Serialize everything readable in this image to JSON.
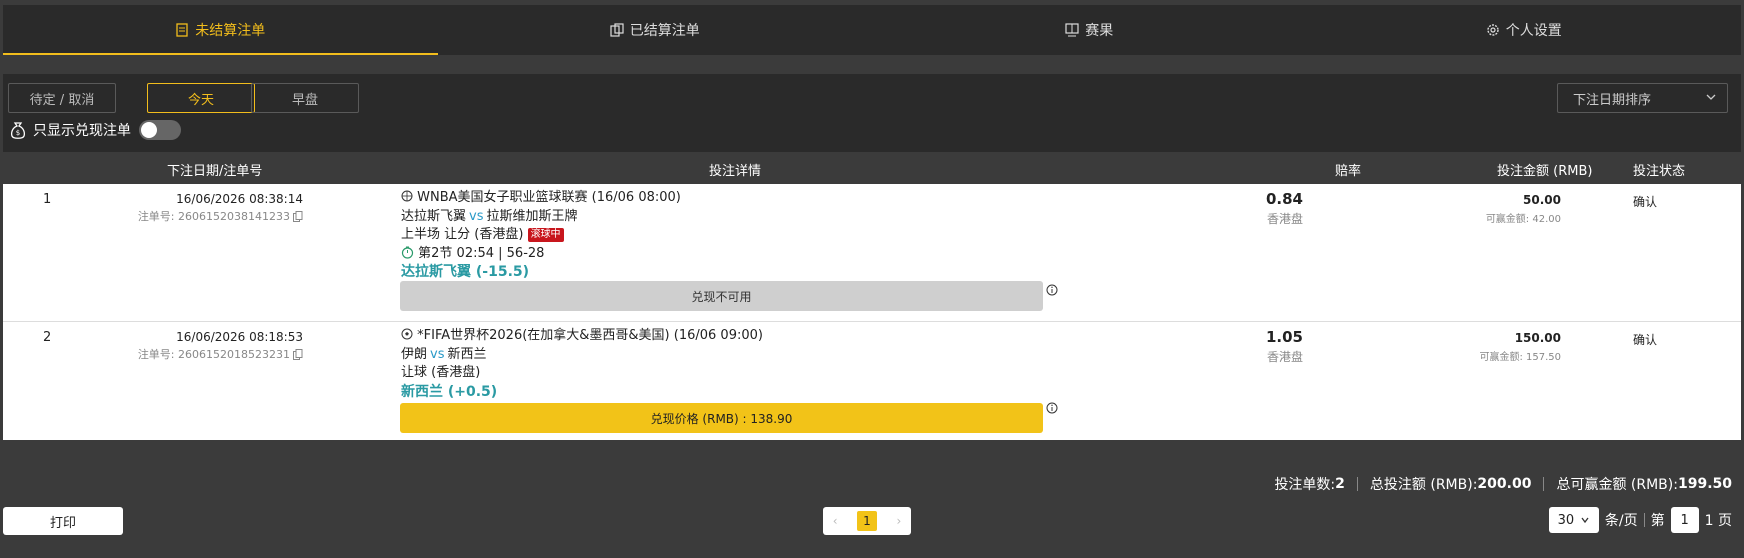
{
  "tabs": [
    {
      "label": "未结算注单",
      "icon": "ticket-icon",
      "active": true
    },
    {
      "label": "已结算注单",
      "icon": "copy-ticket-icon",
      "active": false
    },
    {
      "label": "赛果",
      "icon": "scoreboard-icon",
      "active": false
    },
    {
      "label": "个人设置",
      "icon": "gear-icon",
      "active": false
    }
  ],
  "filters": {
    "buttons": [
      "待定 / 取消",
      "今天",
      "早盘"
    ],
    "active": "今天",
    "sort_value": "下注日期排序",
    "cashout_only_label": "只显示兑现注单",
    "cashout_only_on": false
  },
  "table": {
    "headers": {
      "date": "下注日期/注单号",
      "detail": "投注详情",
      "odds": "赔率",
      "amount": "投注金额 (RMB)",
      "status": "投注状态"
    },
    "rows": [
      {
        "index": "1",
        "date": "16/06/2026 08:38:14",
        "order_label": "注单号: 2606152038141233",
        "league_icon": "basketball-icon",
        "league": "WNBA美国女子职业篮球联赛 (16/06 08:00)",
        "home": "达拉斯飞翼",
        "vs": "vs",
        "away": "拉斯维加斯王牌",
        "market": "上半场 让分 (香港盘)",
        "live_badge": "滚球中",
        "live_info": "第2节 02:54 | 56-28",
        "pick": "达拉斯飞翼 (-15.5)",
        "cashout_label": "兑现不可用",
        "cashout_available": false,
        "odds": "0.84",
        "odds_type": "香港盘",
        "stake": "50.00",
        "win_label": "可赢金额: 42.00",
        "status": "确认"
      },
      {
        "index": "2",
        "date": "16/06/2026 08:18:53",
        "order_label": "注单号: 2606152018523231",
        "league_icon": "soccer-ball-icon",
        "league": "*FIFA世界杯2026(在加拿大&墨西哥&美国) (16/06 09:00)",
        "home": "伊朗",
        "vs": "vs",
        "away": "新西兰",
        "market": "让球 (香港盘)",
        "pick": "新西兰 (+0.5)",
        "cashout_label": "兑现价格 (RMB) : 138.90",
        "cashout_available": true,
        "odds": "1.05",
        "odds_type": "香港盘",
        "stake": "150.00",
        "win_label": "可赢金额: 157.50",
        "status": "确认"
      }
    ]
  },
  "summary": {
    "count_label": "投注单数:",
    "count": "2",
    "total_stake_label": "总投注额 (RMB):",
    "total_stake": "200.00",
    "total_win_label": "总可赢金额 (RMB):",
    "total_win": "199.50"
  },
  "footer": {
    "print_label": "打印",
    "page": "1",
    "per_page": "30",
    "per_page_suffix": "条/页",
    "page_prefix": "第",
    "page_input": "1",
    "page_suffix": "1 页"
  },
  "colors": {
    "accent": "#f2bd1c",
    "pick": "#2a9aa3",
    "live": "#c8161d"
  }
}
